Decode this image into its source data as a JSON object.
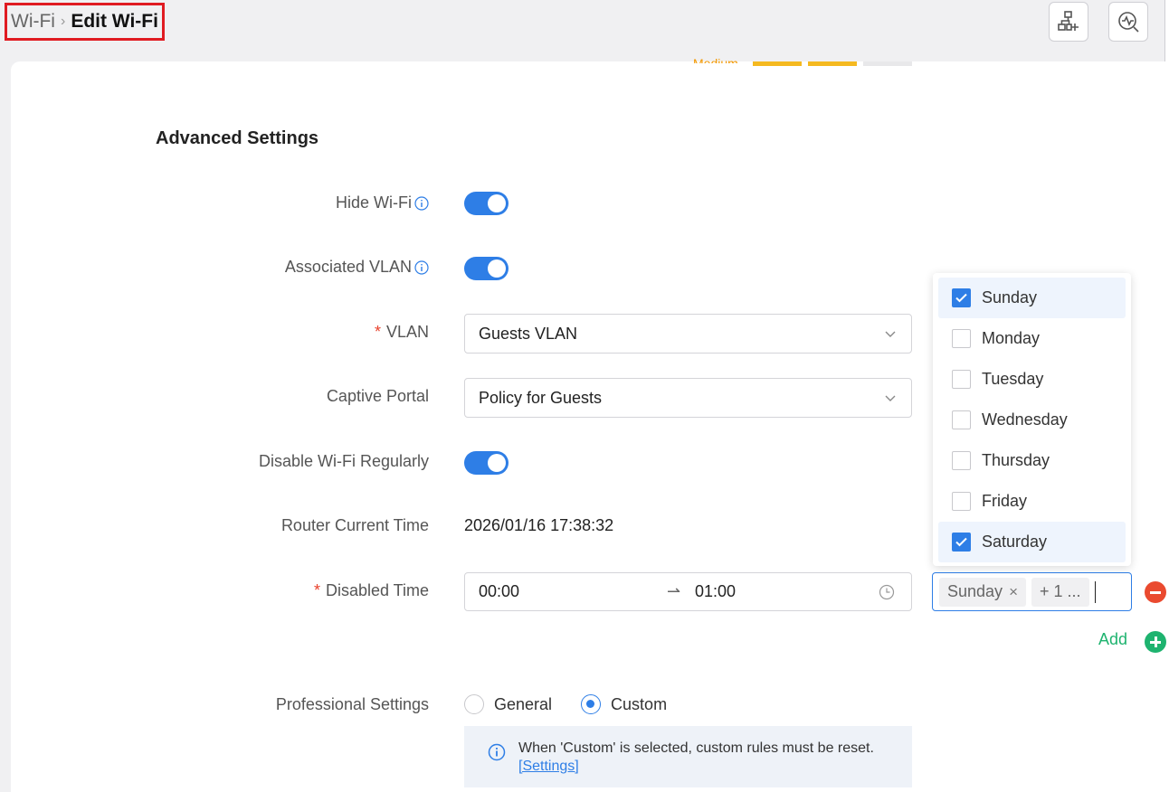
{
  "breadcrumb": {
    "parent": "Wi-Fi",
    "separator": "›",
    "current": "Edit Wi-Fi"
  },
  "strength": {
    "label": "Medium",
    "colors": [
      "#f5b920",
      "#f5b920",
      "#e8e8ea"
    ]
  },
  "section": {
    "title": "Advanced Settings"
  },
  "fields": {
    "hide_wifi": {
      "label": "Hide Wi-Fi",
      "enabled": true
    },
    "associated_vlan": {
      "label": "Associated VLAN",
      "enabled": true
    },
    "vlan": {
      "label": "VLAN",
      "required_mark": "*",
      "value": "Guests VLAN"
    },
    "captive_portal": {
      "label": "Captive Portal",
      "value": "Policy for Guests"
    },
    "disable_regularly": {
      "label": "Disable Wi-Fi Regularly",
      "enabled": true
    },
    "router_time": {
      "label": "Router Current Time",
      "value": "2026/01/16 17:38:32"
    },
    "disabled_time": {
      "label": "Disabled Time",
      "required_mark": "*",
      "start": "00:00",
      "arrow": "⇀",
      "end": "01:00",
      "tags": [
        {
          "label": "Sunday",
          "close": "×"
        }
      ],
      "more_tag": "+ 1 ..."
    },
    "professional": {
      "label": "Professional Settings",
      "options": [
        "General",
        "Custom"
      ],
      "selected": "Custom"
    }
  },
  "add": {
    "label": "Add"
  },
  "days_dropdown": {
    "options": [
      {
        "label": "Sunday",
        "checked": true
      },
      {
        "label": "Monday",
        "checked": false
      },
      {
        "label": "Tuesday",
        "checked": false
      },
      {
        "label": "Wednesday",
        "checked": false
      },
      {
        "label": "Thursday",
        "checked": false
      },
      {
        "label": "Friday",
        "checked": false
      },
      {
        "label": "Saturday",
        "checked": true
      }
    ]
  },
  "notice": {
    "text": "When 'Custom' is selected, custom rules must be reset.",
    "link": "[Settings]"
  },
  "colors": {
    "accent": "#2e7ee6",
    "required": "#e8412c",
    "add": "#1eb36f",
    "remove": "#ea4a2f"
  },
  "icons": {
    "topology_add": "network-add-icon",
    "diagnose": "network-diagnose-icon"
  }
}
